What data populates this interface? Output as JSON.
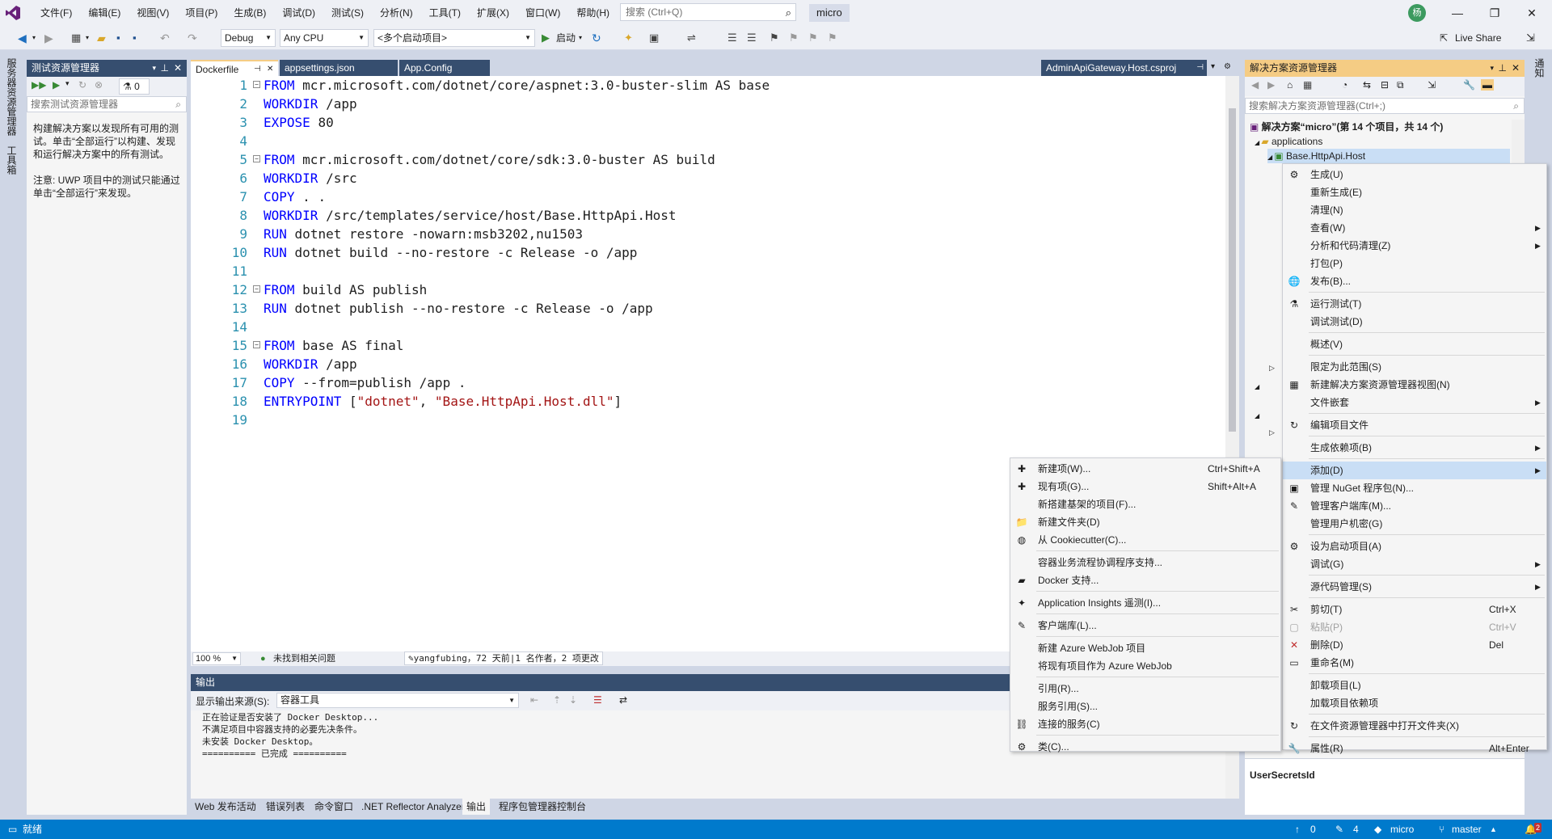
{
  "menubar": {
    "items": [
      "文件(F)",
      "编辑(E)",
      "视图(V)",
      "项目(P)",
      "生成(B)",
      "调试(D)",
      "测试(S)",
      "分析(N)",
      "工具(T)",
      "扩展(X)",
      "窗口(W)",
      "帮助(H)"
    ],
    "search_placeholder": "搜索 (Ctrl+Q)",
    "solution_name": "micro",
    "avatar_text": "杨"
  },
  "toolbar": {
    "config": "Debug",
    "platform": "Any CPU",
    "startup": "<多个启动项目>",
    "start_label": "启动",
    "live_share": "Live Share"
  },
  "left_vtabs": [
    "服务器资源管理器",
    "工具箱"
  ],
  "right_vtabs": [
    "通知"
  ],
  "test_explorer": {
    "title": "测试资源管理器",
    "badge_count": "0",
    "search_placeholder": "搜索测试资源管理器",
    "message_1": "构建解决方案以发现所有可用的测试。单击“全部运行”以构建、发现和运行解决方案中的所有测试。",
    "message_2": "注意: UWP 项目中的测试只能通过单击“全部运行”来发现。"
  },
  "doc_tabs": [
    {
      "label": "Dockerfile",
      "active": true
    },
    {
      "label": "appsettings.json",
      "active": false
    },
    {
      "label": "App.Config",
      "active": false
    }
  ],
  "doc_tab_right": "AdminApiGateway.Host.csproj",
  "editor": {
    "lines": [
      {
        "n": "1",
        "fold": true,
        "parts": [
          [
            "kw",
            "FROM"
          ],
          [
            "",
            "mcr.microsoft.com/dotnet/core/aspnet:3.0-buster-slim AS base"
          ]
        ]
      },
      {
        "n": "2",
        "fold": false,
        "parts": [
          [
            "kw",
            "WORKDIR"
          ],
          [
            "",
            "/app"
          ]
        ]
      },
      {
        "n": "3",
        "fold": false,
        "parts": [
          [
            "kw",
            "EXPOSE"
          ],
          [
            "",
            "80"
          ]
        ]
      },
      {
        "n": "4",
        "fold": false,
        "parts": []
      },
      {
        "n": "5",
        "fold": true,
        "parts": [
          [
            "kw",
            "FROM"
          ],
          [
            "",
            "mcr.microsoft.com/dotnet/core/sdk:3.0-buster AS build"
          ]
        ]
      },
      {
        "n": "6",
        "fold": false,
        "parts": [
          [
            "kw",
            "WORKDIR"
          ],
          [
            "",
            "/src"
          ]
        ]
      },
      {
        "n": "7",
        "fold": false,
        "parts": [
          [
            "kw",
            "COPY"
          ],
          [
            "",
            ". ."
          ]
        ]
      },
      {
        "n": "8",
        "fold": false,
        "parts": [
          [
            "kw",
            "WORKDIR"
          ],
          [
            "",
            "/src/templates/service/host/Base.HttpApi.Host"
          ]
        ]
      },
      {
        "n": "9",
        "fold": false,
        "parts": [
          [
            "kw",
            "RUN"
          ],
          [
            "",
            "dotnet restore -nowarn:msb3202,nu1503"
          ]
        ]
      },
      {
        "n": "10",
        "fold": false,
        "parts": [
          [
            "kw",
            "RUN"
          ],
          [
            "",
            "dotnet build --no-restore -c Release -o /app"
          ]
        ]
      },
      {
        "n": "11",
        "fold": false,
        "parts": []
      },
      {
        "n": "12",
        "fold": true,
        "parts": [
          [
            "kw",
            "FROM"
          ],
          [
            "",
            "build AS publish"
          ]
        ]
      },
      {
        "n": "13",
        "fold": false,
        "parts": [
          [
            "kw",
            "RUN"
          ],
          [
            "",
            "dotnet publish --no-restore -c Release -o /app"
          ]
        ]
      },
      {
        "n": "14",
        "fold": false,
        "parts": []
      },
      {
        "n": "15",
        "fold": true,
        "parts": [
          [
            "kw",
            "FROM"
          ],
          [
            "",
            "base AS final"
          ]
        ]
      },
      {
        "n": "16",
        "fold": false,
        "parts": [
          [
            "kw",
            "WORKDIR"
          ],
          [
            "",
            "/app"
          ]
        ]
      },
      {
        "n": "17",
        "fold": false,
        "parts": [
          [
            "kw",
            "COPY"
          ],
          [
            "",
            "--from=publish /app ."
          ]
        ]
      },
      {
        "n": "18",
        "fold": false,
        "parts": [
          [
            "kw",
            "ENTRYPOINT"
          ],
          [
            "",
            " ["
          ],
          [
            "str",
            "\"dotnet\""
          ],
          [
            "",
            ", "
          ],
          [
            "str",
            "\"Base.HttpApi.Host.dll\""
          ],
          [
            "",
            "]"
          ]
        ]
      },
      {
        "n": "19",
        "fold": false,
        "parts": []
      }
    ],
    "zoom": "100 %",
    "issues": "未找到相关问题",
    "git_info": "yangfubing，72 天前|1 名作者，2 项更改"
  },
  "output": {
    "title": "输出",
    "source_label": "显示输出来源(S):",
    "source_value": "容器工具",
    "lines": "正在验证是否安装了 Docker Desktop...\n不满足项目中容器支持的必要先决条件。\n未安装 Docker Desktop。\n========== 已完成 =========="
  },
  "bottom_tabs": [
    "Web 发布活动",
    "错误列表",
    "命令窗口",
    ".NET Reflector Analyzer",
    "输出",
    "程序包管理器控制台"
  ],
  "solution_explorer": {
    "title": "解决方案资源管理器",
    "search_placeholder": "搜索解决方案资源管理器(Ctrl+;)",
    "root": "解决方案“micro”(第 14 个项目，共 14 个)",
    "folder": "applications",
    "selected_project": "Base.HttpApi.Host",
    "property_name": "UserSecretsId"
  },
  "context_menu": [
    {
      "icon": "⚙",
      "label": "生成(U)",
      "sc": "",
      "sub": false
    },
    {
      "icon": "",
      "label": "重新生成(E)",
      "sc": "",
      "sub": false
    },
    {
      "icon": "",
      "label": "清理(N)",
      "sc": "",
      "sub": false
    },
    {
      "icon": "",
      "label": "查看(W)",
      "sc": "",
      "sub": true
    },
    {
      "icon": "",
      "label": "分析和代码清理(Z)",
      "sc": "",
      "sub": true
    },
    {
      "icon": "",
      "label": "打包(P)",
      "sc": "",
      "sub": false
    },
    {
      "icon": "🌐",
      "label": "发布(B)...",
      "sc": "",
      "sub": false
    },
    {
      "sep": true
    },
    {
      "icon": "⚗",
      "label": "运行测试(T)",
      "sc": "",
      "sub": false
    },
    {
      "icon": "",
      "label": "调试测试(D)",
      "sc": "",
      "sub": false
    },
    {
      "sep": true
    },
    {
      "icon": "",
      "label": "概述(V)",
      "sc": "",
      "sub": false
    },
    {
      "sep": true
    },
    {
      "icon": "",
      "label": "限定为此范围(S)",
      "sc": "",
      "sub": false
    },
    {
      "icon": "▦",
      "label": "新建解决方案资源管理器视图(N)",
      "sc": "",
      "sub": false
    },
    {
      "icon": "",
      "label": "文件嵌套",
      "sc": "",
      "sub": true
    },
    {
      "sep": true
    },
    {
      "icon": "↻",
      "label": "编辑项目文件",
      "sc": "",
      "sub": false
    },
    {
      "sep": true
    },
    {
      "icon": "",
      "label": "生成依赖项(B)",
      "sc": "",
      "sub": true
    },
    {
      "sep": true
    },
    {
      "icon": "",
      "label": "添加(D)",
      "sc": "",
      "sub": true,
      "hl": true
    },
    {
      "icon": "▣",
      "label": "管理 NuGet 程序包(N)...",
      "sc": "",
      "sub": false
    },
    {
      "icon": "✎",
      "label": "管理客户端库(M)...",
      "sc": "",
      "sub": false
    },
    {
      "icon": "",
      "label": "管理用户机密(G)",
      "sc": "",
      "sub": false
    },
    {
      "sep": true
    },
    {
      "icon": "⚙",
      "label": "设为启动项目(A)",
      "sc": "",
      "sub": false
    },
    {
      "icon": "",
      "label": "调试(G)",
      "sc": "",
      "sub": true
    },
    {
      "sep": true
    },
    {
      "icon": "",
      "label": "源代码管理(S)",
      "sc": "",
      "sub": true
    },
    {
      "sep": true
    },
    {
      "icon": "✂",
      "label": "剪切(T)",
      "sc": "Ctrl+X",
      "sub": false
    },
    {
      "icon": "▢",
      "label": "粘贴(P)",
      "sc": "Ctrl+V",
      "sub": false,
      "dis": true
    },
    {
      "icon": "✕",
      "label": "删除(D)",
      "sc": "Del",
      "sub": false,
      "red": true
    },
    {
      "icon": "▭",
      "label": "重命名(M)",
      "sc": "",
      "sub": false
    },
    {
      "sep": true
    },
    {
      "icon": "",
      "label": "卸载项目(L)",
      "sc": "",
      "sub": false
    },
    {
      "icon": "",
      "label": "加载项目依赖项",
      "sc": "",
      "sub": false
    },
    {
      "sep": true
    },
    {
      "icon": "↻",
      "label": "在文件资源管理器中打开文件夹(X)",
      "sc": "",
      "sub": false
    },
    {
      "sep": true
    },
    {
      "icon": "🔧",
      "label": "属性(R)",
      "sc": "Alt+Enter",
      "sub": false
    }
  ],
  "add_submenu": [
    {
      "icon": "✚",
      "label": "新建项(W)...",
      "sc": "Ctrl+Shift+A"
    },
    {
      "icon": "✚",
      "label": "现有项(G)...",
      "sc": "Shift+Alt+A"
    },
    {
      "icon": "",
      "label": "新搭建基架的项目(F)...",
      "sc": ""
    },
    {
      "icon": "📁",
      "label": "新建文件夹(D)",
      "sc": ""
    },
    {
      "icon": "◍",
      "label": "从 Cookiecutter(C)...",
      "sc": ""
    },
    {
      "sep": true
    },
    {
      "icon": "",
      "label": "容器业务流程协调程序支持...",
      "sc": ""
    },
    {
      "icon": "▰",
      "label": "Docker 支持...",
      "sc": ""
    },
    {
      "sep": true
    },
    {
      "icon": "✦",
      "label": "Application Insights 遥测(I)...",
      "sc": ""
    },
    {
      "sep": true
    },
    {
      "icon": "✎",
      "label": "客户端库(L)...",
      "sc": ""
    },
    {
      "sep": true
    },
    {
      "icon": "",
      "label": "新建 Azure WebJob 项目",
      "sc": ""
    },
    {
      "icon": "",
      "label": "将现有项目作为 Azure WebJob",
      "sc": ""
    },
    {
      "sep": true
    },
    {
      "icon": "",
      "label": "引用(R)...",
      "sc": ""
    },
    {
      "icon": "",
      "label": "服务引用(S)...",
      "sc": ""
    },
    {
      "icon": "⛓",
      "label": "连接的服务(C)",
      "sc": ""
    },
    {
      "sep": true
    },
    {
      "icon": "⚙",
      "label": "类(C)...",
      "sc": ""
    }
  ],
  "statusbar": {
    "left": "就绪",
    "up_count": "0",
    "edit_count": "4",
    "repo": "micro",
    "branch": "master",
    "notif_count": "2"
  },
  "colors": {
    "accent": "#007acc",
    "keyword": "#0000ff",
    "string": "#a31515",
    "tab_active_border": "#f5cc84"
  }
}
